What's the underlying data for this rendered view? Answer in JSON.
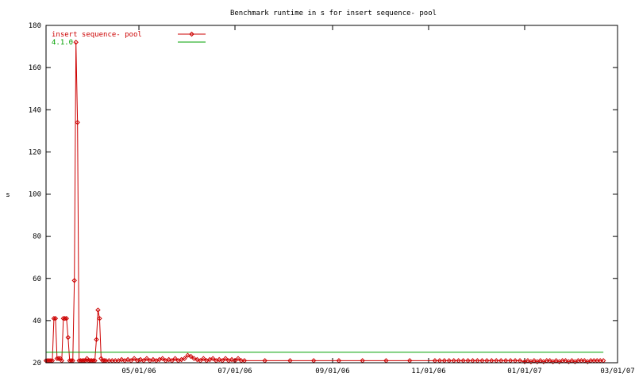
{
  "chart_data": {
    "type": "line",
    "title": "Benchmark runtime in s for insert sequence-  pool",
    "ylabel": "s",
    "xlabel": "",
    "ylim": [
      20,
      180
    ],
    "y_ticks": [
      20,
      40,
      60,
      80,
      100,
      120,
      140,
      160,
      180
    ],
    "x_range": [
      "2006-03-03",
      "2007-03-01"
    ],
    "x_ticks": [
      {
        "date": "2006-05-01",
        "label": "05/01/06"
      },
      {
        "date": "2006-07-01",
        "label": "07/01/06"
      },
      {
        "date": "2006-09-01",
        "label": "09/01/06"
      },
      {
        "date": "2006-11-01",
        "label": "11/01/06"
      },
      {
        "date": "2007-01-01",
        "label": "01/01/07"
      },
      {
        "date": "2007-03-01",
        "label": "03/01/07"
      }
    ],
    "grid": false,
    "legend_position": "top-left",
    "series": [
      {
        "name": "insert sequence-  pool",
        "color": "#cc0000",
        "marker": "diamond",
        "points": [
          [
            "2006-03-03",
            21
          ],
          [
            "2006-03-04",
            21
          ],
          [
            "2006-03-05",
            21
          ],
          [
            "2006-03-06",
            21
          ],
          [
            "2006-03-07",
            21
          ],
          [
            "2006-03-08",
            41
          ],
          [
            "2006-03-09",
            41
          ],
          [
            "2006-03-10",
            22
          ],
          [
            "2006-03-11",
            22
          ],
          [
            "2006-03-12",
            22
          ],
          [
            "2006-03-13",
            21
          ],
          [
            "2006-03-14",
            41
          ],
          [
            "2006-03-15",
            41
          ],
          [
            "2006-03-16",
            41
          ],
          [
            "2006-03-17",
            32
          ],
          [
            "2006-03-18",
            21
          ],
          [
            "2006-03-19",
            21
          ],
          [
            "2006-03-20",
            21
          ],
          [
            "2006-03-21",
            59
          ],
          [
            "2006-03-22",
            172
          ],
          [
            "2006-03-23",
            134
          ],
          [
            "2006-03-24",
            21
          ],
          [
            "2006-03-25",
            21
          ],
          [
            "2006-03-26",
            21
          ],
          [
            "2006-03-27",
            21
          ],
          [
            "2006-03-28",
            21
          ],
          [
            "2006-03-29",
            22
          ],
          [
            "2006-03-30",
            21
          ],
          [
            "2006-03-31",
            21
          ],
          [
            "2006-04-01",
            21
          ],
          [
            "2006-04-02",
            21
          ],
          [
            "2006-04-03",
            21
          ],
          [
            "2006-04-04",
            31
          ],
          [
            "2006-04-05",
            45
          ],
          [
            "2006-04-06",
            41
          ],
          [
            "2006-04-07",
            22
          ],
          [
            "2006-04-08",
            21
          ],
          [
            "2006-04-09",
            21
          ],
          [
            "2006-04-10",
            21
          ],
          [
            "2006-04-12",
            21
          ],
          [
            "2006-04-14",
            21
          ],
          [
            "2006-04-16",
            21
          ],
          [
            "2006-04-18",
            21
          ],
          [
            "2006-04-20",
            21.5
          ],
          [
            "2006-04-22",
            21
          ],
          [
            "2006-04-24",
            21.5
          ],
          [
            "2006-04-26",
            21
          ],
          [
            "2006-04-28",
            22
          ],
          [
            "2006-04-30",
            21
          ],
          [
            "2006-05-02",
            21.5
          ],
          [
            "2006-05-04",
            21
          ],
          [
            "2006-05-06",
            22
          ],
          [
            "2006-05-08",
            21
          ],
          [
            "2006-05-10",
            21.5
          ],
          [
            "2006-05-12",
            21
          ],
          [
            "2006-05-14",
            21.5
          ],
          [
            "2006-05-16",
            22
          ],
          [
            "2006-05-18",
            21
          ],
          [
            "2006-05-20",
            21.5
          ],
          [
            "2006-05-22",
            21
          ],
          [
            "2006-05-24",
            22
          ],
          [
            "2006-05-26",
            21
          ],
          [
            "2006-05-28",
            21.5
          ],
          [
            "2006-05-30",
            22
          ],
          [
            "2006-06-01",
            23.5
          ],
          [
            "2006-06-03",
            23
          ],
          [
            "2006-06-05",
            22
          ],
          [
            "2006-06-07",
            21.5
          ],
          [
            "2006-06-09",
            21
          ],
          [
            "2006-06-11",
            22
          ],
          [
            "2006-06-13",
            21
          ],
          [
            "2006-06-15",
            21.5
          ],
          [
            "2006-06-17",
            22
          ],
          [
            "2006-06-19",
            21
          ],
          [
            "2006-06-21",
            21.5
          ],
          [
            "2006-06-23",
            21
          ],
          [
            "2006-06-25",
            22
          ],
          [
            "2006-06-27",
            21
          ],
          [
            "2006-06-29",
            21.5
          ],
          [
            "2006-07-01",
            21
          ],
          [
            "2006-07-03",
            22
          ],
          [
            "2006-07-05",
            21
          ],
          [
            "2006-07-07",
            21
          ],
          [
            "2006-07-20",
            21
          ],
          [
            "2006-08-05",
            21
          ],
          [
            "2006-08-20",
            21
          ],
          [
            "2006-09-05",
            21
          ],
          [
            "2006-09-20",
            21
          ],
          [
            "2006-10-05",
            21
          ],
          [
            "2006-10-20",
            21
          ],
          [
            "2006-11-05",
            21
          ],
          [
            "2006-11-08",
            21
          ],
          [
            "2006-11-11",
            21
          ],
          [
            "2006-11-14",
            21
          ],
          [
            "2006-11-17",
            21
          ],
          [
            "2006-11-20",
            21
          ],
          [
            "2006-11-23",
            21
          ],
          [
            "2006-11-26",
            21
          ],
          [
            "2006-11-29",
            21
          ],
          [
            "2006-12-02",
            21
          ],
          [
            "2006-12-05",
            21
          ],
          [
            "2006-12-08",
            21
          ],
          [
            "2006-12-11",
            21
          ],
          [
            "2006-12-14",
            21
          ],
          [
            "2006-12-17",
            21
          ],
          [
            "2006-12-20",
            21
          ],
          [
            "2006-12-23",
            21
          ],
          [
            "2006-12-26",
            21
          ],
          [
            "2006-12-29",
            21
          ],
          [
            "2007-01-01",
            20.5
          ],
          [
            "2007-01-03",
            21
          ],
          [
            "2007-01-05",
            20.5
          ],
          [
            "2007-01-07",
            21
          ],
          [
            "2007-01-09",
            20.5
          ],
          [
            "2007-01-11",
            21
          ],
          [
            "2007-01-13",
            20.5
          ],
          [
            "2007-01-15",
            21
          ],
          [
            "2007-01-17",
            21
          ],
          [
            "2007-01-19",
            20.5
          ],
          [
            "2007-01-21",
            21
          ],
          [
            "2007-01-23",
            20.5
          ],
          [
            "2007-01-25",
            21
          ],
          [
            "2007-01-27",
            21
          ],
          [
            "2007-01-29",
            20.5
          ],
          [
            "2007-01-31",
            21
          ],
          [
            "2007-02-02",
            20.5
          ],
          [
            "2007-02-04",
            21
          ],
          [
            "2007-02-06",
            21
          ],
          [
            "2007-02-08",
            21
          ],
          [
            "2007-02-10",
            20.5
          ],
          [
            "2007-02-12",
            21
          ],
          [
            "2007-02-14",
            21
          ],
          [
            "2007-02-16",
            21
          ],
          [
            "2007-02-18",
            21
          ],
          [
            "2007-02-20",
            21
          ]
        ]
      },
      {
        "name": "4.1.0",
        "color": "#00a000",
        "marker": "none",
        "points": [
          [
            "2006-03-03",
            25
          ],
          [
            "2007-02-20",
            25
          ]
        ]
      }
    ]
  }
}
